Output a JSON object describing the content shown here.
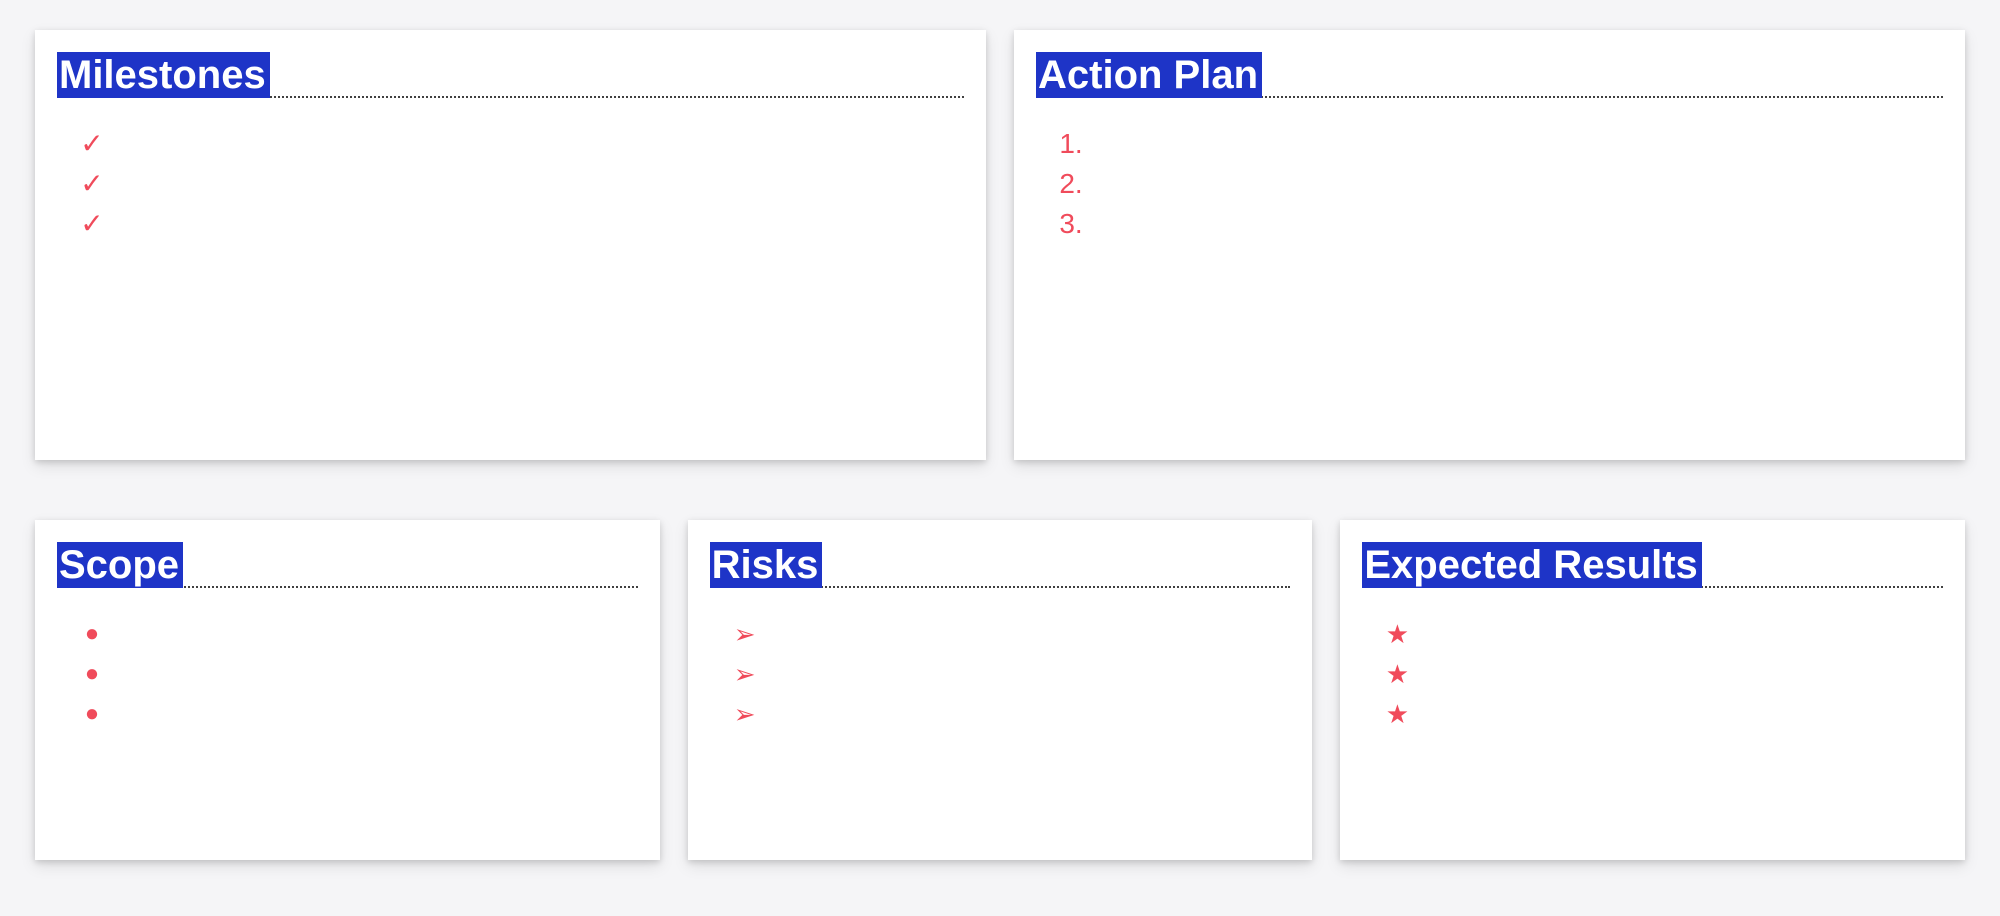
{
  "cards": {
    "milestones": {
      "title": "Milestones",
      "bullets": [
        "check",
        "check",
        "check"
      ],
      "items": [
        "",
        "",
        ""
      ]
    },
    "action_plan": {
      "title": "Action Plan",
      "bullets": [
        "1.",
        "2.",
        "3."
      ],
      "items": [
        "",
        "",
        ""
      ]
    },
    "scope": {
      "title": "Scope",
      "bullets": [
        "dot",
        "dot",
        "dot"
      ],
      "items": [
        "",
        "",
        ""
      ]
    },
    "risks": {
      "title": "Risks",
      "bullets": [
        "arrow",
        "arrow",
        "arrow"
      ],
      "items": [
        "",
        "",
        ""
      ]
    },
    "expected_results": {
      "title": "Expected Results",
      "bullets": [
        "star",
        "star",
        "star"
      ],
      "items": [
        "",
        "",
        ""
      ]
    }
  },
  "glyphs": {
    "check": "✓",
    "dot": "●",
    "arrow": "➢",
    "star": "★"
  },
  "colors": {
    "title_bg": "#1e34c7",
    "title_fg": "#ffffff",
    "accent": "#f04b5b"
  }
}
